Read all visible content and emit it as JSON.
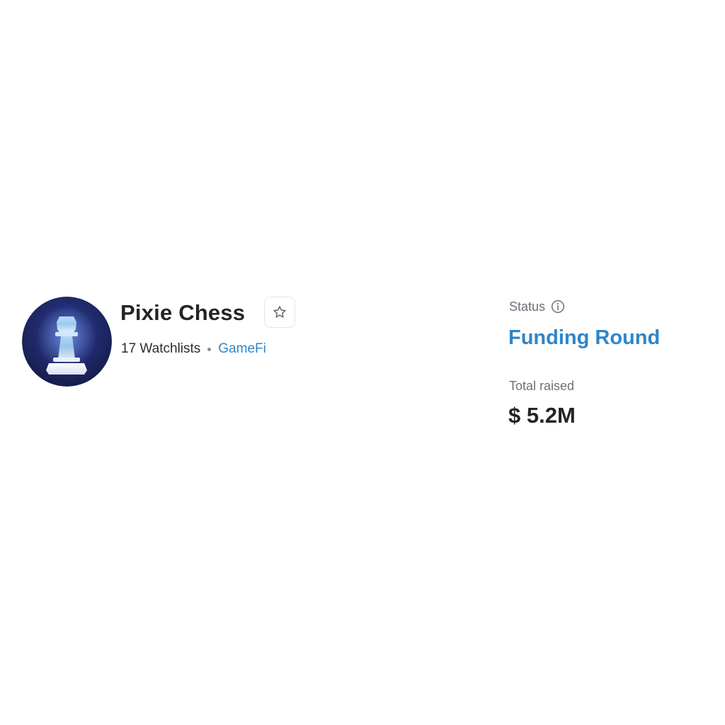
{
  "project": {
    "logo_icon": "chess-pawn-icon",
    "name": "Pixie Chess",
    "watchlists": "17 Watchlists",
    "category": "GameFi",
    "watchlist_button_icon": "star-icon"
  },
  "status": {
    "label": "Status",
    "info_icon": "info-icon",
    "value": "Funding Round"
  },
  "funding": {
    "label": "Total raised",
    "value": "$ 5.2M"
  },
  "colors": {
    "accent": "#2f86c9",
    "text_primary": "#222428",
    "text_secondary": "#6c7077",
    "logo_background": "#1f2a6b"
  }
}
